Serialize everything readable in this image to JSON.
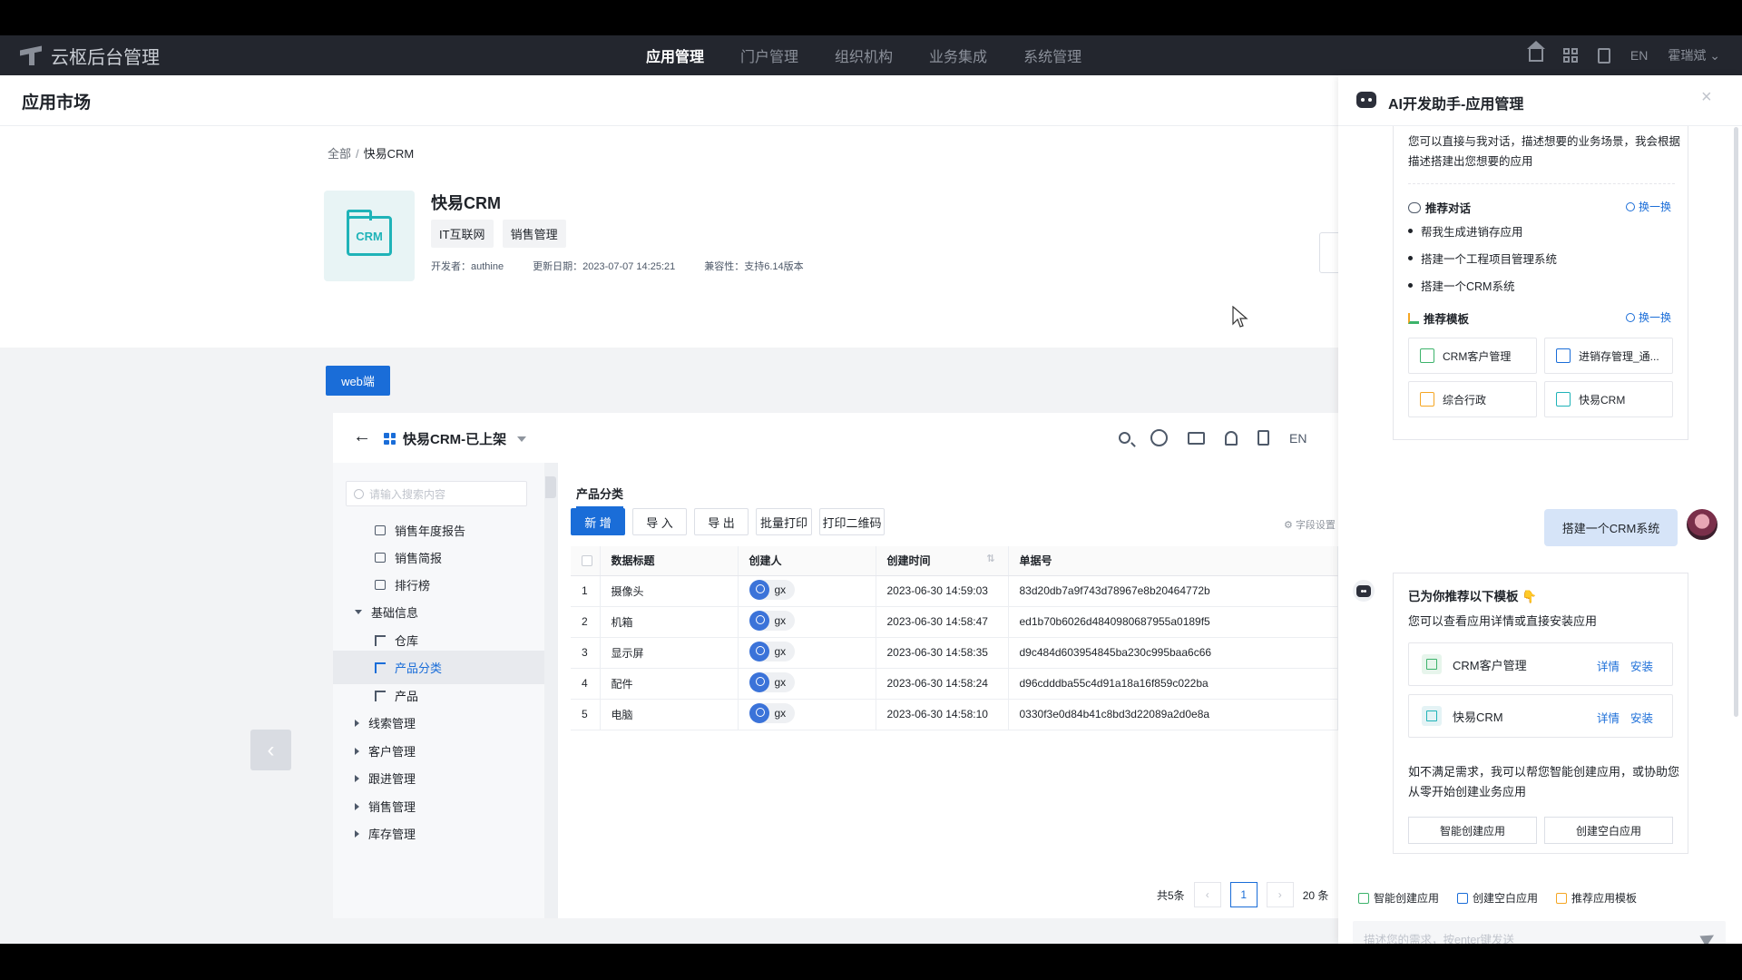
{
  "topnav": {
    "brand": "云枢后台管理",
    "menu": [
      {
        "label": "应用管理",
        "active": true
      },
      {
        "label": "门户管理",
        "active": false
      },
      {
        "label": "组织机构",
        "active": false
      },
      {
        "label": "业务集成",
        "active": false
      },
      {
        "label": "系统管理",
        "active": false
      }
    ],
    "lang": "EN",
    "user": "霍瑞斌"
  },
  "page": {
    "title": "应用市场",
    "breadcrumb": {
      "root": "全部",
      "separator": "/",
      "current": "快易CRM"
    },
    "app": {
      "icon_text": "CRM",
      "name": "快易CRM",
      "tags": [
        "IT互联网",
        "销售管理"
      ],
      "developer": "开发者：authine",
      "updated": "更新日期：2023-07-07 14:25:21",
      "compat": "兼容性：支持6.14版本"
    },
    "web_button": "web端"
  },
  "preview": {
    "title": "快易CRM-已上架",
    "lang": "EN",
    "search_placeholder": "请输入搜索内容",
    "menu": [
      {
        "label": "销售年度报告",
        "type": "report"
      },
      {
        "label": "销售简报",
        "type": "report"
      },
      {
        "label": "排行榜",
        "type": "report"
      },
      {
        "label": "基础信息",
        "type": "group-open"
      },
      {
        "label": "仓库",
        "type": "tree"
      },
      {
        "label": "产品分类",
        "type": "tree",
        "active": true
      },
      {
        "label": "产品",
        "type": "tree"
      },
      {
        "label": "线索管理",
        "type": "group"
      },
      {
        "label": "客户管理",
        "type": "group"
      },
      {
        "label": "跟进管理",
        "type": "group"
      },
      {
        "label": "销售管理",
        "type": "group"
      },
      {
        "label": "库存管理",
        "type": "group"
      }
    ],
    "tab": "产品分类",
    "toolbar": [
      "新 增",
      "导 入",
      "导 出",
      "批量打印",
      "打印二维码"
    ],
    "field_settings": "字段设置",
    "columns": [
      "数据标题",
      "创建人",
      "创建时间",
      "单据号"
    ],
    "rows": [
      {
        "idx": "1",
        "title": "摄像头",
        "creator": "gx",
        "time": "2023-06-30 14:59:03",
        "no": "83d20db7a9f743d78967e8b20464772b"
      },
      {
        "idx": "2",
        "title": "机箱",
        "creator": "gx",
        "time": "2023-06-30 14:58:47",
        "no": "ed1b70b6026d4840980687955a0189f5"
      },
      {
        "idx": "3",
        "title": "显示屏",
        "creator": "gx",
        "time": "2023-06-30 14:58:35",
        "no": "d9c484d603954845ba230c995baa6c66"
      },
      {
        "idx": "4",
        "title": "配件",
        "creator": "gx",
        "time": "2023-06-30 14:58:24",
        "no": "d96cdddba55c4d91a18a16f859c022ba"
      },
      {
        "idx": "5",
        "title": "电脑",
        "creator": "gx",
        "time": "2023-06-30 14:58:10",
        "no": "0330f3e0d84b41c8bd3d22089a2d0e8a"
      }
    ],
    "pager": {
      "total": "共5条",
      "page": "1",
      "size": "20 条"
    }
  },
  "ai": {
    "title": "AI开发助手-应用管理",
    "intro": "您可以直接与我对话，描述想要的业务场景，我会根据描述搭建出您想要的应用",
    "recommend_chat": "推荐对话",
    "swap": "换一换",
    "suggestions": [
      "帮我生成进销存应用",
      "搭建一个工程项目管理系统",
      "搭建一个CRM系统"
    ],
    "recommend_tpl": "推荐模板",
    "templates": [
      {
        "label": "CRM客户管理",
        "color": "#3cb36b"
      },
      {
        "label": "进销存管理_通...",
        "color": "#1a6dd8"
      },
      {
        "label": "综合行政",
        "color": "#f5a623"
      },
      {
        "label": "快易CRM",
        "color": "#1fb3b8"
      }
    ],
    "user_message": "搭建一个CRM系统",
    "reply_title": "已为你推荐以下模板 👇",
    "reply_sub": "您可以查看应用详情或直接安装应用",
    "reply_items": [
      {
        "label": "CRM客户管理",
        "detail": "详情",
        "install": "安装"
      },
      {
        "label": "快易CRM",
        "detail": "详情",
        "install": "安装"
      }
    ],
    "reply_text": "如不满足需求，我可以帮您智能创建应用，或协助您从零开始创建业务应用",
    "btn_smart": "智能创建应用",
    "btn_blank": "创建空白应用",
    "quick": [
      "智能创建应用",
      "创建空白应用",
      "推荐应用模板"
    ],
    "input_placeholder": "描述您的需求，按enter键发送"
  }
}
